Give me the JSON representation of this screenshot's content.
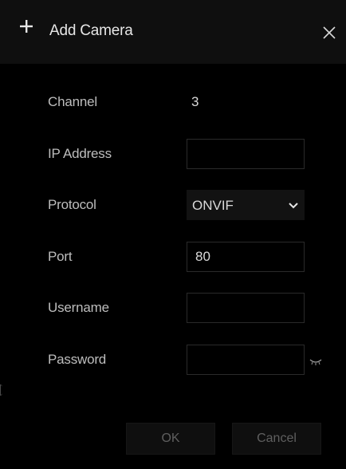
{
  "dialog": {
    "title": "Add Camera",
    "icons": {
      "add": "plus-icon",
      "close": "close-icon"
    }
  },
  "form": {
    "channel": {
      "label": "Channel",
      "value": "3"
    },
    "ip_address": {
      "label": "IP Address",
      "value": ""
    },
    "protocol": {
      "label": "Protocol",
      "selected": "ONVIF"
    },
    "port": {
      "label": "Port",
      "value": "80"
    },
    "username": {
      "label": "Username",
      "value": ""
    },
    "password": {
      "label": "Password",
      "value": ""
    }
  },
  "buttons": {
    "ok": "OK",
    "cancel": "Cancel"
  },
  "colors": {
    "background": "#000000",
    "title_bar": "#0f0f0f",
    "text": "#d9d9d9",
    "label": "#bdbdbd",
    "disabled_text": "#5f5f5f"
  }
}
